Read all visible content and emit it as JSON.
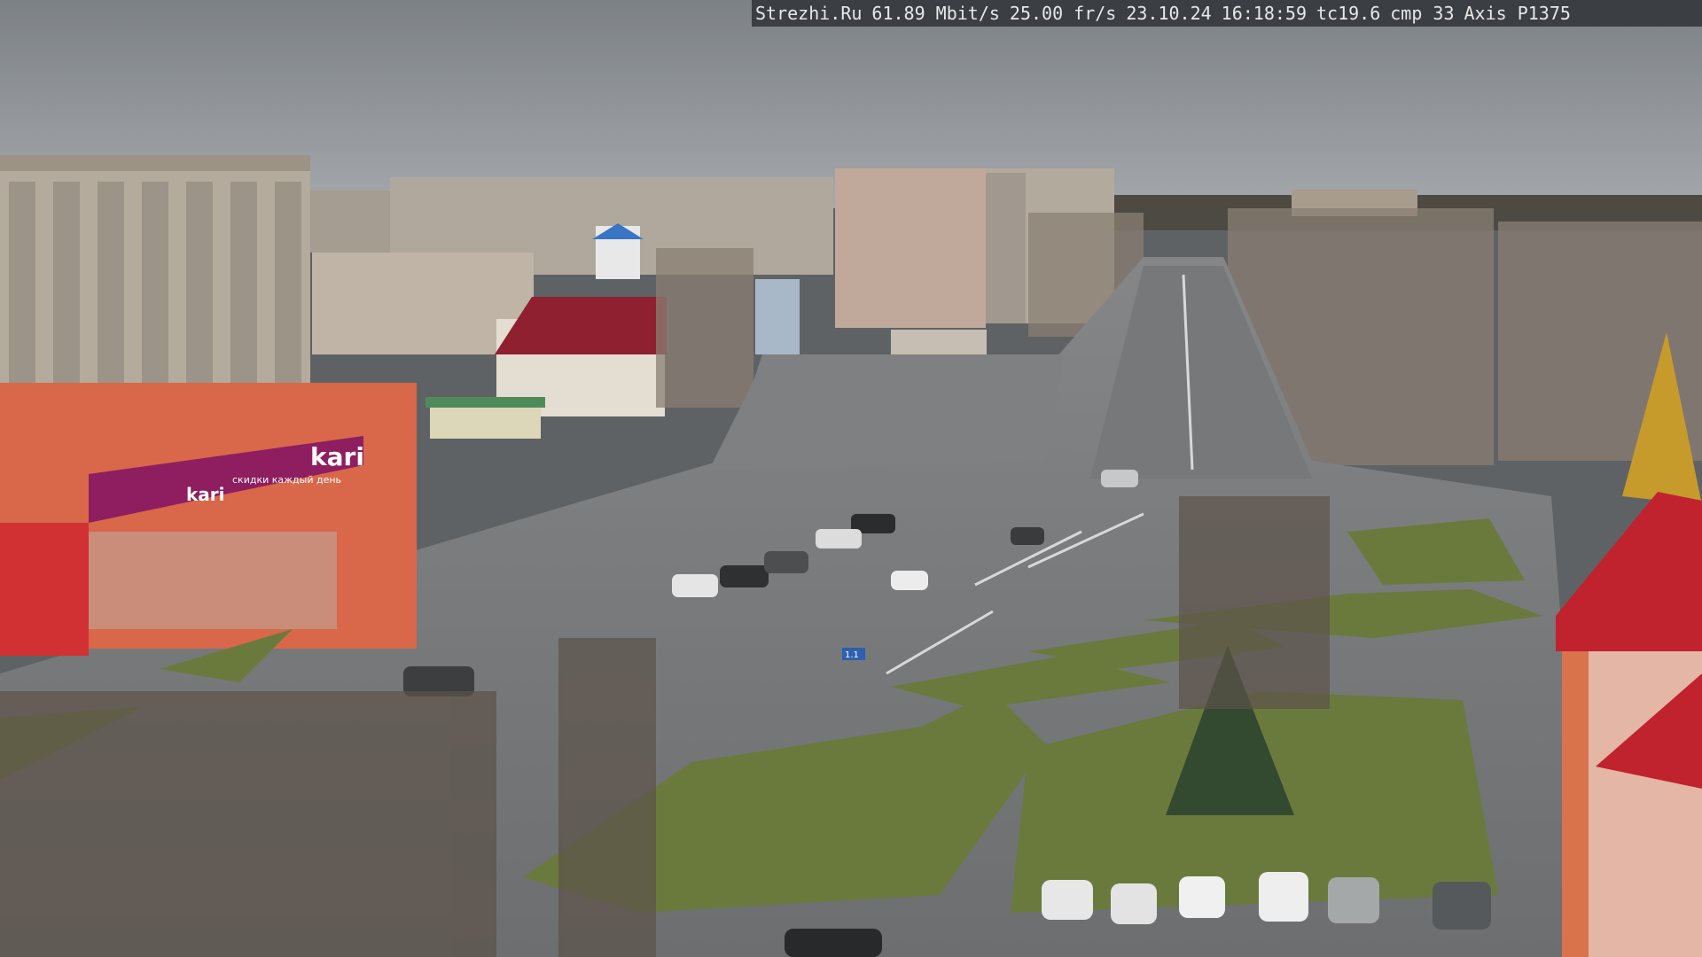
{
  "camera_overlay": {
    "site": "Strezhi.Ru",
    "bitrate": "61.89 Mbit/s",
    "framerate": "25.00 fr/s",
    "date": "23.10.24",
    "time": "16:18:59",
    "tc": "tc19.6",
    "cmp": "cmp 33",
    "model": "Axis P1375"
  },
  "signs": {
    "store_main": "kari",
    "store_side": "kari",
    "store_caption": "скидки каждый день",
    "street_sign": "1.1"
  },
  "colors": {
    "sky": "#8c9196",
    "road": "#6f7274",
    "grass": "#6a7a3c",
    "store_facade": "#d9674a",
    "store_banner": "#8e1e5f",
    "roof_red": "#c0222e"
  }
}
